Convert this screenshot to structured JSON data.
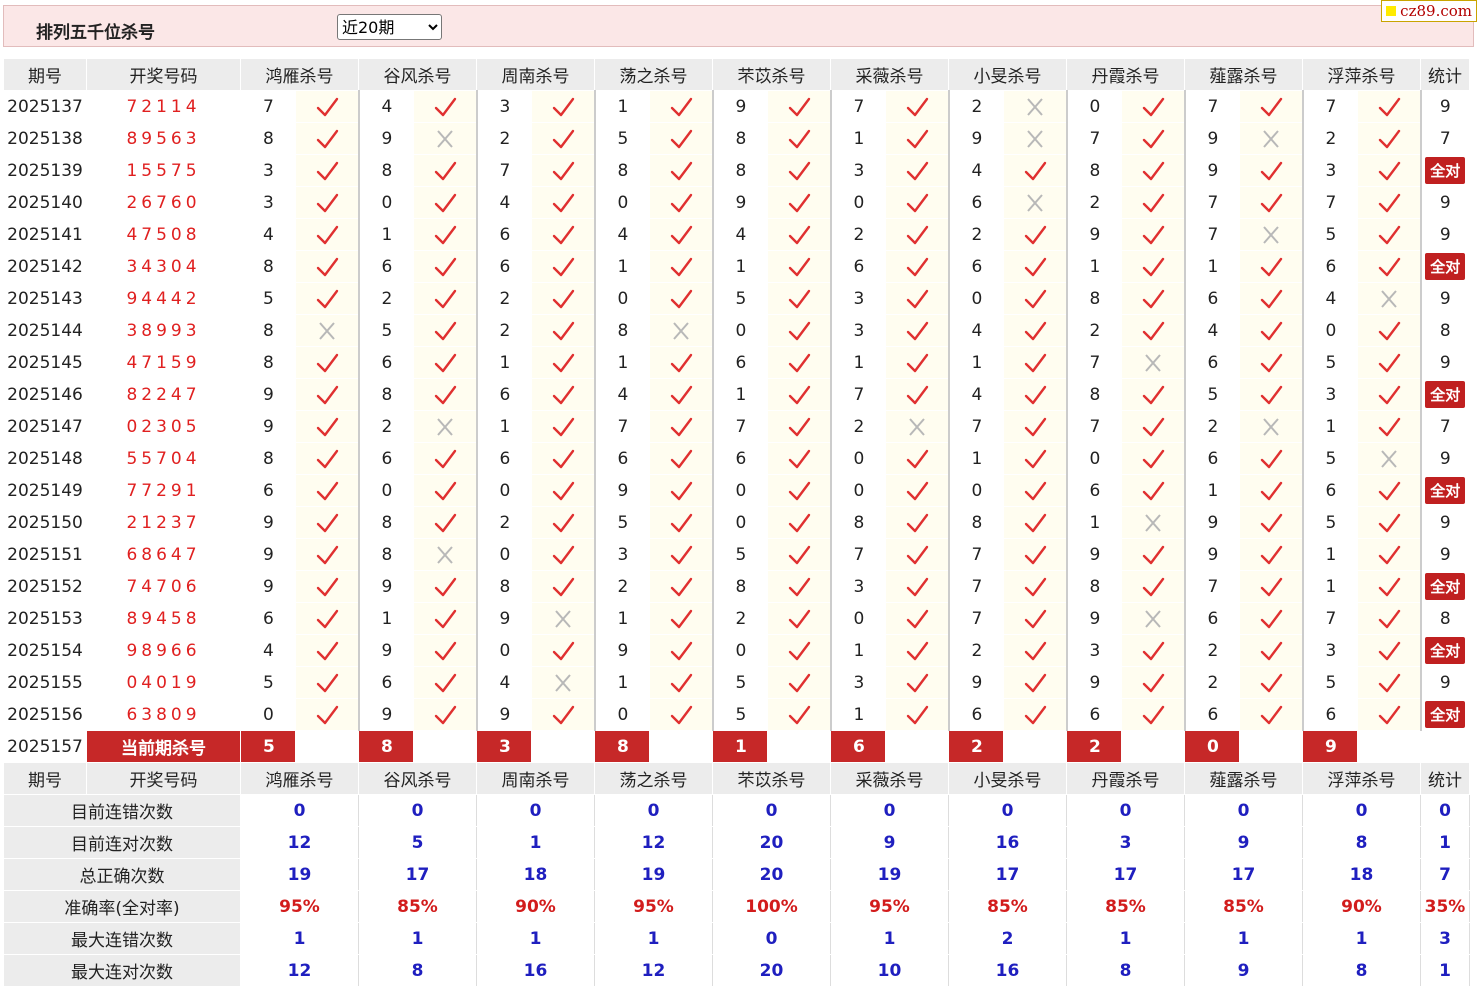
{
  "header": {
    "title": "排列五千位杀号",
    "select_value": "近20期",
    "logo_text": "cz89.com"
  },
  "columns": [
    "期号",
    "开奖号码",
    "鸿雁杀号",
    "谷风杀号",
    "周南杀号",
    "荡之杀号",
    "芣苡杀号",
    "采薇杀号",
    "小旻杀号",
    "丹霞杀号",
    "薤露杀号",
    "浮萍杀号",
    "统计"
  ],
  "rows": [
    {
      "p": "2025137",
      "n": "72114",
      "k": [
        [
          7,
          1
        ],
        [
          4,
          1
        ],
        [
          3,
          1
        ],
        [
          1,
          1
        ],
        [
          9,
          1
        ],
        [
          7,
          1
        ],
        [
          2,
          0
        ],
        [
          0,
          1
        ],
        [
          7,
          1
        ],
        [
          7,
          1
        ]
      ],
      "s": "9"
    },
    {
      "p": "2025138",
      "n": "89563",
      "k": [
        [
          8,
          1
        ],
        [
          9,
          0
        ],
        [
          2,
          1
        ],
        [
          5,
          1
        ],
        [
          8,
          1
        ],
        [
          1,
          1
        ],
        [
          9,
          0
        ],
        [
          7,
          1
        ],
        [
          9,
          0
        ],
        [
          2,
          1
        ]
      ],
      "s": "7"
    },
    {
      "p": "2025139",
      "n": "15575",
      "k": [
        [
          3,
          1
        ],
        [
          8,
          1
        ],
        [
          7,
          1
        ],
        [
          8,
          1
        ],
        [
          8,
          1
        ],
        [
          3,
          1
        ],
        [
          4,
          1
        ],
        [
          8,
          1
        ],
        [
          9,
          1
        ],
        [
          3,
          1
        ]
      ],
      "s": "全对"
    },
    {
      "p": "2025140",
      "n": "26760",
      "k": [
        [
          3,
          1
        ],
        [
          0,
          1
        ],
        [
          4,
          1
        ],
        [
          0,
          1
        ],
        [
          9,
          1
        ],
        [
          0,
          1
        ],
        [
          6,
          0
        ],
        [
          2,
          1
        ],
        [
          7,
          1
        ],
        [
          7,
          1
        ]
      ],
      "s": "9"
    },
    {
      "p": "2025141",
      "n": "47508",
      "k": [
        [
          4,
          1
        ],
        [
          1,
          1
        ],
        [
          6,
          1
        ],
        [
          4,
          1
        ],
        [
          4,
          1
        ],
        [
          2,
          1
        ],
        [
          2,
          1
        ],
        [
          9,
          1
        ],
        [
          7,
          0
        ],
        [
          5,
          1
        ]
      ],
      "s": "9"
    },
    {
      "p": "2025142",
      "n": "34304",
      "k": [
        [
          8,
          1
        ],
        [
          6,
          1
        ],
        [
          6,
          1
        ],
        [
          1,
          1
        ],
        [
          1,
          1
        ],
        [
          6,
          1
        ],
        [
          6,
          1
        ],
        [
          1,
          1
        ],
        [
          1,
          1
        ],
        [
          6,
          1
        ]
      ],
      "s": "全对"
    },
    {
      "p": "2025143",
      "n": "94442",
      "k": [
        [
          5,
          1
        ],
        [
          2,
          1
        ],
        [
          2,
          1
        ],
        [
          0,
          1
        ],
        [
          5,
          1
        ],
        [
          3,
          1
        ],
        [
          0,
          1
        ],
        [
          8,
          1
        ],
        [
          6,
          1
        ],
        [
          4,
          0
        ]
      ],
      "s": "9"
    },
    {
      "p": "2025144",
      "n": "38993",
      "k": [
        [
          8,
          0
        ],
        [
          5,
          1
        ],
        [
          2,
          1
        ],
        [
          8,
          0
        ],
        [
          0,
          1
        ],
        [
          3,
          1
        ],
        [
          4,
          1
        ],
        [
          2,
          1
        ],
        [
          4,
          1
        ],
        [
          0,
          1
        ]
      ],
      "s": "8"
    },
    {
      "p": "2025145",
      "n": "47159",
      "k": [
        [
          8,
          1
        ],
        [
          6,
          1
        ],
        [
          1,
          1
        ],
        [
          1,
          1
        ],
        [
          6,
          1
        ],
        [
          1,
          1
        ],
        [
          1,
          1
        ],
        [
          7,
          0
        ],
        [
          6,
          1
        ],
        [
          5,
          1
        ]
      ],
      "s": "9"
    },
    {
      "p": "2025146",
      "n": "82247",
      "k": [
        [
          9,
          1
        ],
        [
          8,
          1
        ],
        [
          6,
          1
        ],
        [
          4,
          1
        ],
        [
          1,
          1
        ],
        [
          7,
          1
        ],
        [
          4,
          1
        ],
        [
          8,
          1
        ],
        [
          5,
          1
        ],
        [
          3,
          1
        ]
      ],
      "s": "全对"
    },
    {
      "p": "2025147",
      "n": "02305",
      "k": [
        [
          9,
          1
        ],
        [
          2,
          0
        ],
        [
          1,
          1
        ],
        [
          7,
          1
        ],
        [
          7,
          1
        ],
        [
          2,
          0
        ],
        [
          7,
          1
        ],
        [
          7,
          1
        ],
        [
          2,
          0
        ],
        [
          1,
          1
        ]
      ],
      "s": "7"
    },
    {
      "p": "2025148",
      "n": "55704",
      "k": [
        [
          8,
          1
        ],
        [
          6,
          1
        ],
        [
          6,
          1
        ],
        [
          6,
          1
        ],
        [
          6,
          1
        ],
        [
          0,
          1
        ],
        [
          1,
          1
        ],
        [
          0,
          1
        ],
        [
          6,
          1
        ],
        [
          5,
          0
        ]
      ],
      "s": "9"
    },
    {
      "p": "2025149",
      "n": "77291",
      "k": [
        [
          6,
          1
        ],
        [
          0,
          1
        ],
        [
          0,
          1
        ],
        [
          9,
          1
        ],
        [
          0,
          1
        ],
        [
          0,
          1
        ],
        [
          0,
          1
        ],
        [
          6,
          1
        ],
        [
          1,
          1
        ],
        [
          6,
          1
        ]
      ],
      "s": "全对"
    },
    {
      "p": "2025150",
      "n": "21237",
      "k": [
        [
          9,
          1
        ],
        [
          8,
          1
        ],
        [
          2,
          1
        ],
        [
          5,
          1
        ],
        [
          0,
          1
        ],
        [
          8,
          1
        ],
        [
          8,
          1
        ],
        [
          1,
          0
        ],
        [
          9,
          1
        ],
        [
          5,
          1
        ]
      ],
      "s": "9"
    },
    {
      "p": "2025151",
      "n": "68647",
      "k": [
        [
          9,
          1
        ],
        [
          8,
          0
        ],
        [
          0,
          1
        ],
        [
          3,
          1
        ],
        [
          5,
          1
        ],
        [
          7,
          1
        ],
        [
          7,
          1
        ],
        [
          9,
          1
        ],
        [
          9,
          1
        ],
        [
          1,
          1
        ]
      ],
      "s": "9"
    },
    {
      "p": "2025152",
      "n": "74706",
      "k": [
        [
          9,
          1
        ],
        [
          9,
          1
        ],
        [
          8,
          1
        ],
        [
          2,
          1
        ],
        [
          8,
          1
        ],
        [
          3,
          1
        ],
        [
          7,
          1
        ],
        [
          8,
          1
        ],
        [
          7,
          1
        ],
        [
          1,
          1
        ]
      ],
      "s": "全对"
    },
    {
      "p": "2025153",
      "n": "89458",
      "k": [
        [
          6,
          1
        ],
        [
          1,
          1
        ],
        [
          9,
          0
        ],
        [
          1,
          1
        ],
        [
          2,
          1
        ],
        [
          0,
          1
        ],
        [
          7,
          1
        ],
        [
          9,
          0
        ],
        [
          6,
          1
        ],
        [
          7,
          1
        ]
      ],
      "s": "8"
    },
    {
      "p": "2025154",
      "n": "98966",
      "k": [
        [
          4,
          1
        ],
        [
          9,
          1
        ],
        [
          0,
          1
        ],
        [
          9,
          1
        ],
        [
          0,
          1
        ],
        [
          1,
          1
        ],
        [
          2,
          1
        ],
        [
          3,
          1
        ],
        [
          2,
          1
        ],
        [
          3,
          1
        ]
      ],
      "s": "全对"
    },
    {
      "p": "2025155",
      "n": "04019",
      "k": [
        [
          5,
          1
        ],
        [
          6,
          1
        ],
        [
          4,
          0
        ],
        [
          1,
          1
        ],
        [
          5,
          1
        ],
        [
          3,
          1
        ],
        [
          9,
          1
        ],
        [
          9,
          1
        ],
        [
          2,
          1
        ],
        [
          5,
          1
        ]
      ],
      "s": "9"
    },
    {
      "p": "2025156",
      "n": "63809",
      "k": [
        [
          0,
          1
        ],
        [
          9,
          1
        ],
        [
          9,
          1
        ],
        [
          0,
          1
        ],
        [
          5,
          1
        ],
        [
          1,
          1
        ],
        [
          6,
          1
        ],
        [
          6,
          1
        ],
        [
          6,
          1
        ],
        [
          6,
          1
        ]
      ],
      "s": "全对"
    }
  ],
  "current": {
    "p": "2025157",
    "label": "当前期杀号",
    "k": [
      "5",
      "8",
      "3",
      "8",
      "1",
      "6",
      "2",
      "2",
      "0",
      "9"
    ]
  },
  "stats": [
    {
      "label": "目前连错次数",
      "v": [
        "0",
        "0",
        "0",
        "0",
        "0",
        "0",
        "0",
        "0",
        "0",
        "0",
        "0"
      ],
      "red": false
    },
    {
      "label": "目前连对次数",
      "v": [
        "12",
        "5",
        "1",
        "12",
        "20",
        "9",
        "16",
        "3",
        "9",
        "8",
        "1"
      ],
      "red": false
    },
    {
      "label": "总正确次数",
      "v": [
        "19",
        "17",
        "18",
        "19",
        "20",
        "19",
        "17",
        "17",
        "17",
        "18",
        "7"
      ],
      "red": false
    },
    {
      "label": "准确率(全对率)",
      "v": [
        "95%",
        "85%",
        "90%",
        "95%",
        "100%",
        "95%",
        "85%",
        "85%",
        "85%",
        "90%",
        "35%"
      ],
      "red": true
    },
    {
      "label": "最大连错次数",
      "v": [
        "1",
        "1",
        "1",
        "1",
        "0",
        "1",
        "2",
        "1",
        "1",
        "1",
        "3"
      ],
      "red": false
    },
    {
      "label": "最大连对次数",
      "v": [
        "12",
        "8",
        "16",
        "12",
        "20",
        "10",
        "16",
        "8",
        "9",
        "8",
        "1"
      ],
      "red": false
    }
  ]
}
